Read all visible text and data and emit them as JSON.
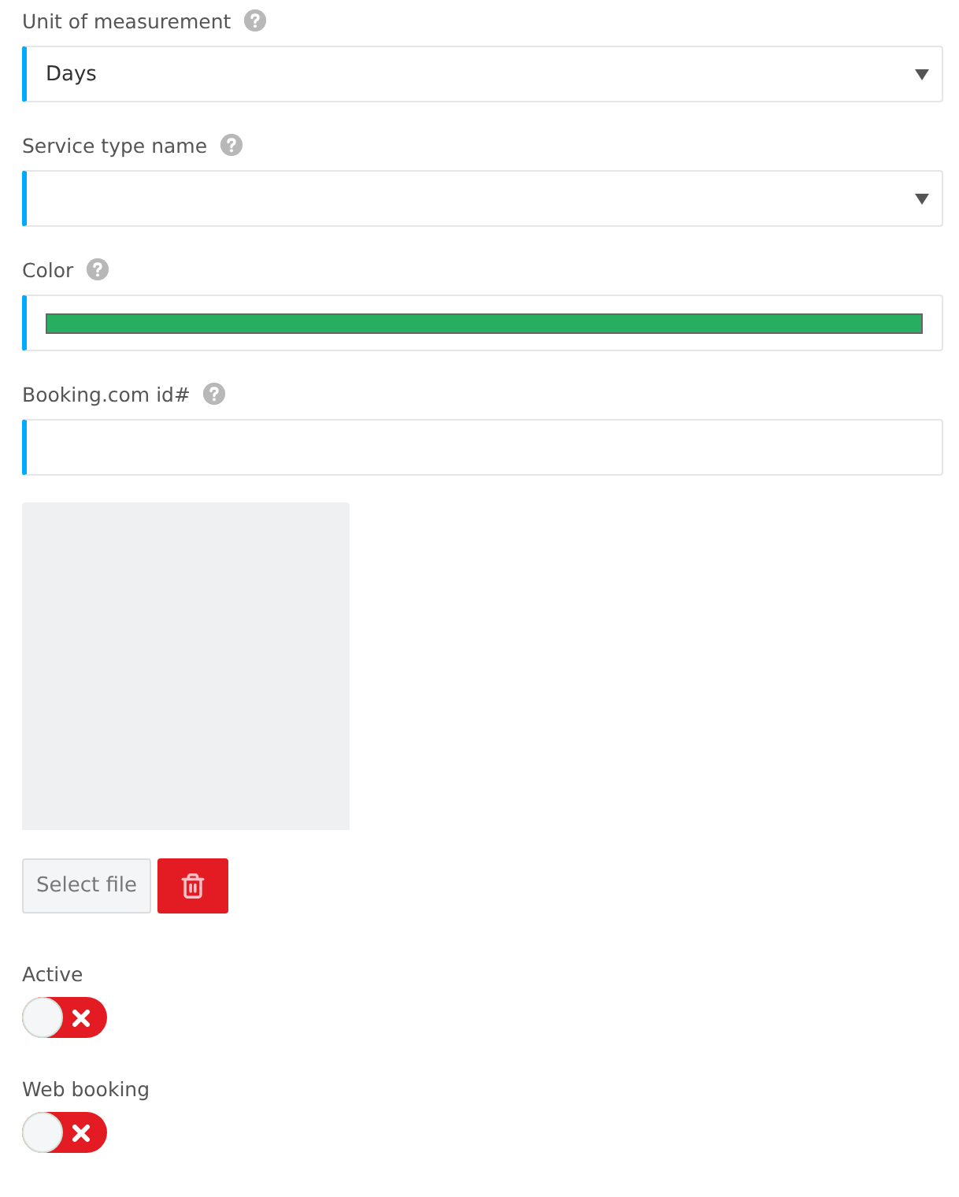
{
  "fields": [
    {
      "kind": "select",
      "label": "Unit of measurement",
      "value": "Days"
    },
    {
      "kind": "select",
      "label": "Service type name"
    },
    {
      "kind": "color",
      "label": "Color",
      "color": "#27ae60"
    },
    {
      "kind": "text",
      "label": "Booking.com id#"
    }
  ],
  "image": {
    "kind": "picture",
    "select_button": "Select file"
  },
  "toggles": [
    {
      "label": "Active",
      "on": false
    },
    {
      "label": "Web booking",
      "on": false
    }
  ]
}
